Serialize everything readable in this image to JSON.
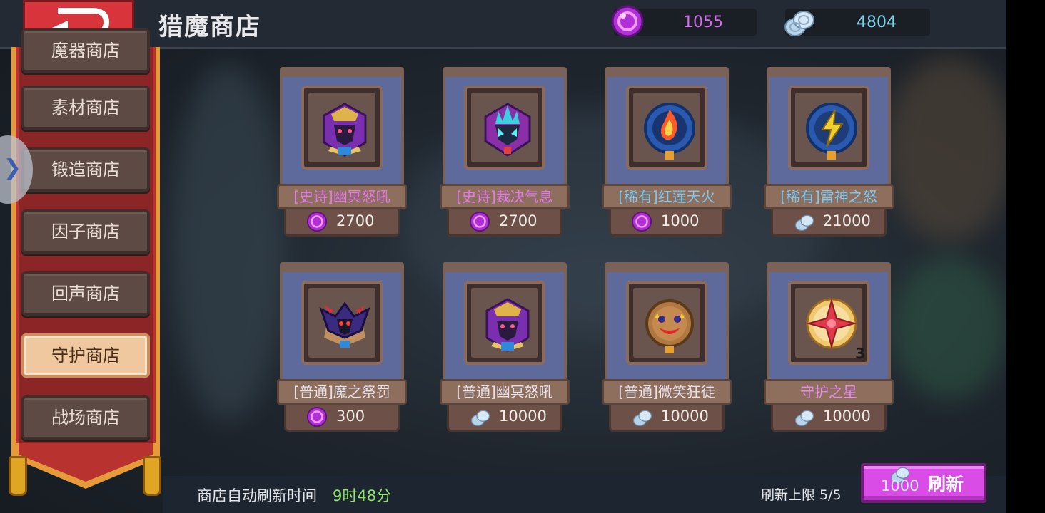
{
  "header": {
    "title": "猎魔商店",
    "back_icon": "back-arrow-icon",
    "gems": "1055",
    "silver": "4804",
    "gem_color": "#d96cf0",
    "silver_color": "#7fd4ea"
  },
  "sidebar": {
    "items": [
      {
        "label": "魔器商店"
      },
      {
        "label": "素材商店"
      },
      {
        "label": "锻造商店"
      },
      {
        "label": "因子商店"
      },
      {
        "label": "回声商店"
      },
      {
        "label": "守护商店",
        "active": true
      },
      {
        "label": "战场商店"
      }
    ],
    "toggle_icon": "chevron-right-icon"
  },
  "shop": {
    "items": [
      {
        "name": "[史诗]幽冥怒吼",
        "rarity": "epic",
        "currency": "gem-icon",
        "price": "2700",
        "icon": "purple-demon-mask-icon"
      },
      {
        "name": "[史诗]裁决气息",
        "rarity": "epic",
        "currency": "gem-icon",
        "price": "2700",
        "icon": "crystal-demon-icon"
      },
      {
        "name": "[稀有]红莲天火",
        "rarity": "rare",
        "currency": "gem-icon",
        "price": "1000",
        "icon": "fire-orb-icon"
      },
      {
        "name": "[稀有]雷神之怒",
        "rarity": "rare",
        "currency": "silver-icon",
        "price": "21000",
        "icon": "lightning-orb-icon"
      },
      {
        "name": "[普通]魔之祭罚",
        "rarity": "common",
        "currency": "gem-icon",
        "price": "300",
        "icon": "dark-winged-demon-icon"
      },
      {
        "name": "[普通]幽冥怒吼",
        "rarity": "common",
        "currency": "silver-icon",
        "price": "10000",
        "icon": "purple-demon-mask-icon"
      },
      {
        "name": "[普通]微笑狂徒",
        "rarity": "common",
        "currency": "silver-icon",
        "price": "10000",
        "icon": "smiling-mask-icon"
      },
      {
        "name": "守护之星",
        "rarity": "special",
        "currency": "silver-icon",
        "price": "10000",
        "icon": "guardian-star-icon",
        "quantity": "3"
      }
    ]
  },
  "footer": {
    "refresh_time_label": "商店自动刷新时间",
    "refresh_time_value": "9时48分",
    "refresh_limit": "刷新上限 5/5",
    "refresh_cost": "1000",
    "refresh_button_label": "刷新"
  }
}
